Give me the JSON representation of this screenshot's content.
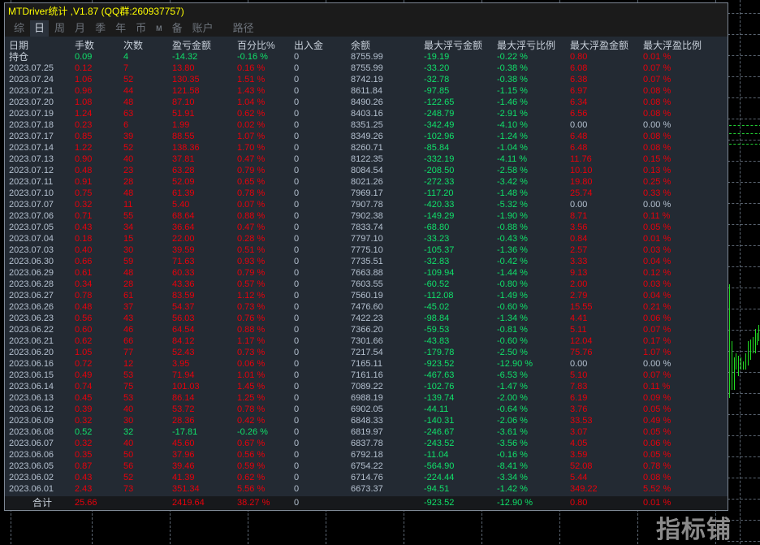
{
  "window_title": "MTDriver统计 ,V1.87 (QQ群:260937757)",
  "tabs": [
    {
      "label": "综",
      "active": false
    },
    {
      "label": "日",
      "active": true
    },
    {
      "label": "周",
      "active": false
    },
    {
      "label": "月",
      "active": false
    },
    {
      "label": "季",
      "active": false
    },
    {
      "label": "年",
      "active": false
    },
    {
      "label": "币",
      "active": false
    },
    {
      "label": "M",
      "active": false
    },
    {
      "label": "备",
      "active": false
    },
    {
      "label": "账户",
      "active": false
    },
    {
      "label": "路径",
      "active": false
    }
  ],
  "columns": [
    "日期",
    "手数",
    "次数",
    "盈亏金额",
    "百分比%",
    "出入金",
    "余额",
    "最大浮亏金额",
    "最大浮亏比例",
    "最大浮盈金额",
    "最大浮盈比例"
  ],
  "colors": {
    "profit": "#e8000b",
    "loss": "#10e06a",
    "neutral": "#b4c0cf",
    "title": "#ffff00"
  },
  "rows": [
    [
      "持仓",
      "0.09",
      "4",
      "-14.32",
      "-0.16 %",
      "0",
      "8755.99",
      "-19.19",
      "-0.22 %",
      "0.80",
      "0.01 %"
    ],
    [
      "2023.07.25",
      "0.12",
      "7",
      "13.80",
      "0.16 %",
      "0",
      "8755.99",
      "-33.20",
      "-0.38 %",
      "6.08",
      "0.07 %"
    ],
    [
      "2023.07.24",
      "1.06",
      "52",
      "130.35",
      "1.51 %",
      "0",
      "8742.19",
      "-32.78",
      "-0.38 %",
      "6.38",
      "0.07 %"
    ],
    [
      "2023.07.21",
      "0.96",
      "44",
      "121.58",
      "1.43 %",
      "0",
      "8611.84",
      "-97.85",
      "-1.15 %",
      "6.97",
      "0.08 %"
    ],
    [
      "2023.07.20",
      "1.08",
      "48",
      "87.10",
      "1.04 %",
      "0",
      "8490.26",
      "-122.65",
      "-1.46 %",
      "6.34",
      "0.08 %"
    ],
    [
      "2023.07.19",
      "1.24",
      "63",
      "51.91",
      "0.62 %",
      "0",
      "8403.16",
      "-248.79",
      "-2.91 %",
      "6.56",
      "0.08 %"
    ],
    [
      "2023.07.18",
      "0.23",
      "6",
      "1.99",
      "0.02 %",
      "0",
      "8351.25",
      "-342.49",
      "-4.10 %",
      "0.00",
      "0.00 %"
    ],
    [
      "2023.07.17",
      "0.85",
      "39",
      "88.55",
      "1.07 %",
      "0",
      "8349.26",
      "-102.96",
      "-1.24 %",
      "6.48",
      "0.08 %"
    ],
    [
      "2023.07.14",
      "1.22",
      "52",
      "138.36",
      "1.70 %",
      "0",
      "8260.71",
      "-85.84",
      "-1.04 %",
      "6.48",
      "0.08 %"
    ],
    [
      "2023.07.13",
      "0.90",
      "40",
      "37.81",
      "0.47 %",
      "0",
      "8122.35",
      "-332.19",
      "-4.11 %",
      "11.76",
      "0.15 %"
    ],
    [
      "2023.07.12",
      "0.48",
      "23",
      "63.28",
      "0.79 %",
      "0",
      "8084.54",
      "-208.50",
      "-2.58 %",
      "10.10",
      "0.13 %"
    ],
    [
      "2023.07.11",
      "0.91",
      "28",
      "52.09",
      "0.65 %",
      "0",
      "8021.26",
      "-272.33",
      "-3.42 %",
      "19.80",
      "0.25 %"
    ],
    [
      "2023.07.10",
      "0.75",
      "48",
      "61.39",
      "0.78 %",
      "0",
      "7969.17",
      "-117.20",
      "-1.48 %",
      "25.74",
      "0.33 %"
    ],
    [
      "2023.07.07",
      "0.32",
      "11",
      "5.40",
      "0.07 %",
      "0",
      "7907.78",
      "-420.33",
      "-5.32 %",
      "0.00",
      "0.00 %"
    ],
    [
      "2023.07.06",
      "0.71",
      "55",
      "68.64",
      "0.88 %",
      "0",
      "7902.38",
      "-149.29",
      "-1.90 %",
      "8.71",
      "0.11 %"
    ],
    [
      "2023.07.05",
      "0.43",
      "34",
      "36.64",
      "0.47 %",
      "0",
      "7833.74",
      "-68.80",
      "-0.88 %",
      "3.56",
      "0.05 %"
    ],
    [
      "2023.07.04",
      "0.18",
      "15",
      "22.00",
      "0.28 %",
      "0",
      "7797.10",
      "-33.23",
      "-0.43 %",
      "0.84",
      "0.01 %"
    ],
    [
      "2023.07.03",
      "0.40",
      "30",
      "39.59",
      "0.51 %",
      "0",
      "7775.10",
      "-105.37",
      "-1.36 %",
      "2.57",
      "0.03 %"
    ],
    [
      "2023.06.30",
      "0.66",
      "59",
      "71.63",
      "0.93 %",
      "0",
      "7735.51",
      "-32.83",
      "-0.42 %",
      "3.33",
      "0.04 %"
    ],
    [
      "2023.06.29",
      "0.61",
      "48",
      "60.33",
      "0.79 %",
      "0",
      "7663.88",
      "-109.94",
      "-1.44 %",
      "9.13",
      "0.12 %"
    ],
    [
      "2023.06.28",
      "0.34",
      "28",
      "43.36",
      "0.57 %",
      "0",
      "7603.55",
      "-60.52",
      "-0.80 %",
      "2.00",
      "0.03 %"
    ],
    [
      "2023.06.27",
      "0.78",
      "61",
      "83.59",
      "1.12 %",
      "0",
      "7560.19",
      "-112.08",
      "-1.49 %",
      "2.79",
      "0.04 %"
    ],
    [
      "2023.06.26",
      "0.48",
      "37",
      "54.37",
      "0.73 %",
      "0",
      "7476.60",
      "-45.02",
      "-0.60 %",
      "15.55",
      "0.21 %"
    ],
    [
      "2023.06.23",
      "0.56",
      "43",
      "56.03",
      "0.76 %",
      "0",
      "7422.23",
      "-98.84",
      "-1.34 %",
      "4.41",
      "0.06 %"
    ],
    [
      "2023.06.22",
      "0.60",
      "46",
      "64.54",
      "0.88 %",
      "0",
      "7366.20",
      "-59.53",
      "-0.81 %",
      "5.11",
      "0.07 %"
    ],
    [
      "2023.06.21",
      "0.62",
      "66",
      "84.12",
      "1.17 %",
      "0",
      "7301.66",
      "-43.83",
      "-0.60 %",
      "12.04",
      "0.17 %"
    ],
    [
      "2023.06.20",
      "1.05",
      "77",
      "52.43",
      "0.73 %",
      "0",
      "7217.54",
      "-179.78",
      "-2.50 %",
      "75.76",
      "1.07 %"
    ],
    [
      "2023.06.16",
      "0.72",
      "12",
      "3.95",
      "0.06 %",
      "0",
      "7165.11",
      "-923.52",
      "-12.90 %",
      "0.00",
      "0.00 %"
    ],
    [
      "2023.06.15",
      "0.49",
      "53",
      "71.94",
      "1.01 %",
      "0",
      "7161.16",
      "-467.63",
      "-6.53 %",
      "5.10",
      "0.07 %"
    ],
    [
      "2023.06.14",
      "0.74",
      "75",
      "101.03",
      "1.45 %",
      "0",
      "7089.22",
      "-102.76",
      "-1.47 %",
      "7.83",
      "0.11 %"
    ],
    [
      "2023.06.13",
      "0.45",
      "53",
      "86.14",
      "1.25 %",
      "0",
      "6988.19",
      "-139.74",
      "-2.00 %",
      "6.19",
      "0.09 %"
    ],
    [
      "2023.06.12",
      "0.39",
      "40",
      "53.72",
      "0.78 %",
      "0",
      "6902.05",
      "-44.11",
      "-0.64 %",
      "3.76",
      "0.05 %"
    ],
    [
      "2023.06.09",
      "0.32",
      "30",
      "28.36",
      "0.42 %",
      "0",
      "6848.33",
      "-140.31",
      "-2.06 %",
      "33.53",
      "0.49 %"
    ],
    [
      "2023.06.08",
      "0.52",
      "32",
      "-17.81",
      "-0.26 %",
      "0",
      "6819.97",
      "-246.67",
      "-3.61 %",
      "3.07",
      "0.05 %"
    ],
    [
      "2023.06.07",
      "0.32",
      "40",
      "45.60",
      "0.67 %",
      "0",
      "6837.78",
      "-243.52",
      "-3.56 %",
      "4.05",
      "0.06 %"
    ],
    [
      "2023.06.06",
      "0.35",
      "50",
      "37.96",
      "0.56 %",
      "0",
      "6792.18",
      "-11.04",
      "-0.16 %",
      "3.59",
      "0.05 %"
    ],
    [
      "2023.06.05",
      "0.87",
      "56",
      "39.46",
      "0.59 %",
      "0",
      "6754.22",
      "-564.90",
      "-8.41 %",
      "52.08",
      "0.78 %"
    ],
    [
      "2023.06.02",
      "0.43",
      "52",
      "41.39",
      "0.62 %",
      "0",
      "6714.76",
      "-224.44",
      "-3.34 %",
      "5.44",
      "0.08 %"
    ],
    [
      "2023.06.01",
      "2.43",
      "73",
      "351.34",
      "5.56 %",
      "0",
      "6673.37",
      "-94.51",
      "-1.42 %",
      "349.22",
      "5.52 %"
    ]
  ],
  "total": [
    "合计",
    "25.66",
    "",
    "2419.64",
    "38.27 %",
    "0",
    "",
    "-923.52",
    "-12.90 %",
    "0.80",
    "0.01 %"
  ],
  "watermark": "指标铺"
}
